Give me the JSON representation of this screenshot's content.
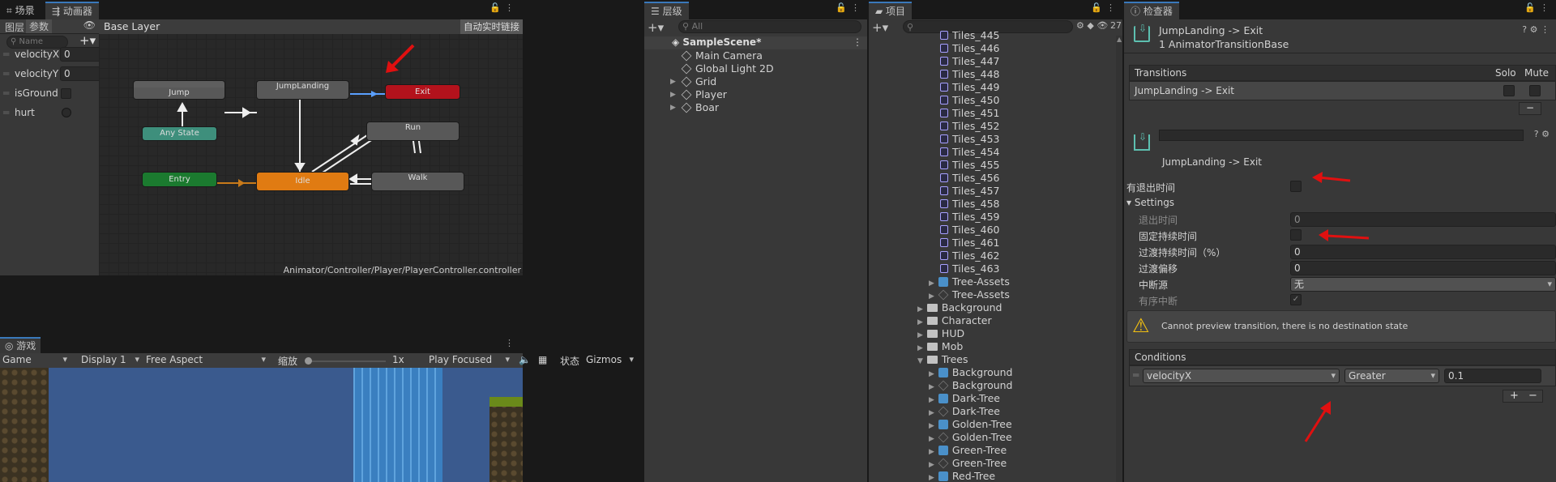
{
  "scene_tab": "场景",
  "animator_tab": "动画器",
  "hierarchy_tab": "层级",
  "project_tab": "项目",
  "inspector_tab": "检查器",
  "animator": {
    "layers_tab": "图层",
    "params_tab": "参数",
    "name_placeholder": "Name",
    "breadcrumb": "Base Layer",
    "autolive": "自动实时链接",
    "params": [
      {
        "name": "velocityX",
        "value": "0",
        "type": "float"
      },
      {
        "name": "velocityY",
        "value": "0",
        "type": "float"
      },
      {
        "name": "isGround",
        "value": "",
        "type": "bool"
      },
      {
        "name": "hurt",
        "value": "",
        "type": "trigger"
      }
    ],
    "states": {
      "jump": "Jump",
      "jumplanding": "JumpLanding",
      "exit": "Exit",
      "anystate": "Any State",
      "run": "Run",
      "entry": "Entry",
      "idle": "Idle",
      "walk": "Walk"
    },
    "path": "Animator/Controller/Player/PlayerController.controller"
  },
  "game": {
    "tab": "游戏",
    "game_select": "Game",
    "display": "Display 1",
    "aspect": "Free Aspect",
    "zoom_label": "缩放",
    "zoom_value": "1x",
    "play_mode": "Play Focused",
    "stats": "状态",
    "gizmos": "Gizmos"
  },
  "hierarchy": {
    "search_placeholder": "All",
    "scene": "SampleScene*",
    "items": [
      "Main Camera",
      "Global Light 2D",
      "Grid",
      "Player",
      "Boar"
    ]
  },
  "project": {
    "count": "27",
    "tiles": [
      "Tiles_445",
      "Tiles_446",
      "Tiles_447",
      "Tiles_448",
      "Tiles_449",
      "Tiles_450",
      "Tiles_451",
      "Tiles_452",
      "Tiles_453",
      "Tiles_454",
      "Tiles_455",
      "Tiles_456",
      "Tiles_457",
      "Tiles_458",
      "Tiles_459",
      "Tiles_460",
      "Tiles_461",
      "Tiles_462",
      "Tiles_463"
    ],
    "after": [
      {
        "t": "Tree-Assets",
        "k": "prefab",
        "d": 1,
        "a": true
      },
      {
        "t": "Tree-Assets",
        "k": "sprite",
        "d": 1,
        "a": true
      },
      {
        "t": "Background",
        "k": "folder",
        "d": 0,
        "a": true
      },
      {
        "t": "Character",
        "k": "folder",
        "d": 0,
        "a": true
      },
      {
        "t": "HUD",
        "k": "folder",
        "d": 0,
        "a": true
      },
      {
        "t": "Mob",
        "k": "folder",
        "d": 0,
        "a": true
      },
      {
        "t": "Trees",
        "k": "folder",
        "d": 0,
        "a": true,
        "open": true
      },
      {
        "t": "Background",
        "k": "prefab",
        "d": 1,
        "a": true
      },
      {
        "t": "Background",
        "k": "sprite",
        "d": 1,
        "a": true
      },
      {
        "t": "Dark-Tree",
        "k": "prefab",
        "d": 1,
        "a": true
      },
      {
        "t": "Dark-Tree",
        "k": "sprite",
        "d": 1,
        "a": true
      },
      {
        "t": "Golden-Tree",
        "k": "prefab",
        "d": 1,
        "a": true
      },
      {
        "t": "Golden-Tree",
        "k": "sprite",
        "d": 1,
        "a": true
      },
      {
        "t": "Green-Tree",
        "k": "prefab",
        "d": 1,
        "a": true
      },
      {
        "t": "Green-Tree",
        "k": "sprite",
        "d": 1,
        "a": true
      },
      {
        "t": "Red-Tree",
        "k": "prefab",
        "d": 1,
        "a": true
      }
    ]
  },
  "inspector": {
    "title": "JumpLanding -> Exit",
    "subtitle": "1 AnimatorTransitionBase",
    "transitions_label": "Transitions",
    "solo": "Solo",
    "mute": "Mute",
    "transition_row": "JumpLanding -> Exit",
    "sub_title": "JumpLanding -> Exit",
    "has_exit_time": "有退出时间",
    "settings": "Settings",
    "exit_time": "退出时间",
    "exit_time_val": "0",
    "fixed_duration": "固定持续时间",
    "duration": "过渡持续时间（%）",
    "duration_val": "0",
    "offset": "过渡偏移",
    "offset_val": "0",
    "interrupt": "中断源",
    "interrupt_val": "无",
    "ordered": "有序中断",
    "warning": "Cannot preview transition, there is no destination state",
    "conditions": "Conditions",
    "cond_param": "velocityX",
    "cond_op": "Greater",
    "cond_val": "0.1"
  }
}
